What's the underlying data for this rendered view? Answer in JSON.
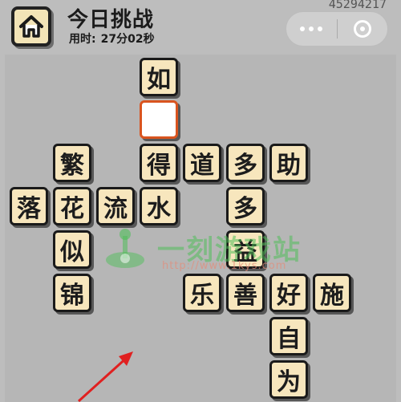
{
  "header": {
    "title": "今日挑战",
    "timer_label": "用时:",
    "timer_value": "27分02秒",
    "game_id": "45294217",
    "home_icon": "home-icon",
    "more_icon": "more-dots-icon",
    "close_icon": "target-circle-icon"
  },
  "board": {
    "tiles": [
      {
        "char": "如"
      },
      {
        "char": ""
      },
      {
        "char": "得"
      },
      {
        "char": "道"
      },
      {
        "char": "多"
      },
      {
        "char": "助"
      },
      {
        "char": "繁"
      },
      {
        "char": "落"
      },
      {
        "char": "花"
      },
      {
        "char": "流"
      },
      {
        "char": "水"
      },
      {
        "char": "多"
      },
      {
        "char": "益"
      },
      {
        "char": "似"
      },
      {
        "char": "锦"
      },
      {
        "char": "乐"
      },
      {
        "char": "善"
      },
      {
        "char": "好"
      },
      {
        "char": "施"
      },
      {
        "char": "自"
      },
      {
        "char": "为"
      }
    ]
  },
  "watermark": {
    "text": "一刻游戏站",
    "url": "http://www.1kys.com",
    "accent": "#50be5a"
  },
  "colors": {
    "background": "#bdbdbd",
    "tile": "#f7e6bd",
    "tile_border": "#1a1a1a",
    "selected_border": "#d9541f",
    "arrow": "#e02020"
  }
}
